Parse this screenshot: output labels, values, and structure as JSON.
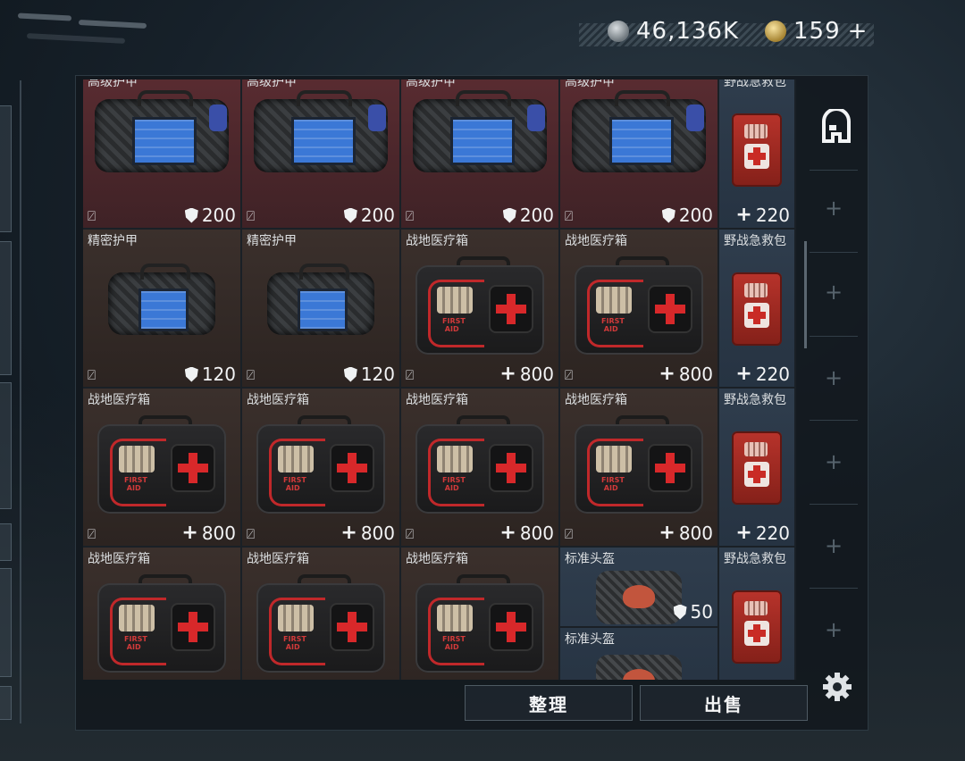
{
  "currency": {
    "silver": "46,136K",
    "gold": "159",
    "gold_suffix": "+"
  },
  "grid": {
    "rows": [
      [
        {
          "name": "高级护甲",
          "value": "200",
          "type": "shield",
          "kind": "armor-bag",
          "bg": "red"
        },
        {
          "name": "高级护甲",
          "value": "200",
          "type": "shield",
          "kind": "armor-bag",
          "bg": "red"
        },
        {
          "name": "高级护甲",
          "value": "200",
          "type": "shield",
          "kind": "armor-bag",
          "bg": "red"
        },
        {
          "name": "高级护甲",
          "value": "200",
          "type": "shield",
          "kind": "armor-bag",
          "bg": "red"
        },
        {
          "name": "野战急救包",
          "value": "220",
          "type": "plus",
          "kind": "pouch",
          "bg": "blue"
        }
      ],
      [
        {
          "name": "精密护甲",
          "value": "120",
          "type": "shield",
          "kind": "armor-small",
          "bg": "brown"
        },
        {
          "name": "精密护甲",
          "value": "120",
          "type": "shield",
          "kind": "armor-small",
          "bg": "brown"
        },
        {
          "name": "战地医疗箱",
          "value": "800",
          "type": "plus",
          "kind": "medkit",
          "bg": "brown"
        },
        {
          "name": "战地医疗箱",
          "value": "800",
          "type": "plus",
          "kind": "medkit",
          "bg": "brown"
        },
        {
          "name": "野战急救包",
          "value": "220",
          "type": "plus",
          "kind": "pouch",
          "bg": "blue"
        }
      ],
      [
        {
          "name": "战地医疗箱",
          "value": "800",
          "type": "plus",
          "kind": "medkit",
          "bg": "brown"
        },
        {
          "name": "战地医疗箱",
          "value": "800",
          "type": "plus",
          "kind": "medkit",
          "bg": "brown"
        },
        {
          "name": "战地医疗箱",
          "value": "800",
          "type": "plus",
          "kind": "medkit",
          "bg": "brown"
        },
        {
          "name": "战地医疗箱",
          "value": "800",
          "type": "plus",
          "kind": "medkit",
          "bg": "brown"
        },
        {
          "name": "野战急救包",
          "value": "220",
          "type": "plus",
          "kind": "pouch",
          "bg": "blue"
        }
      ],
      [
        {
          "name": "战地医疗箱",
          "value": "",
          "type": "",
          "kind": "medkit",
          "bg": "brown"
        },
        {
          "name": "战地医疗箱",
          "value": "",
          "type": "",
          "kind": "medkit",
          "bg": "brown"
        },
        {
          "name": "战地医疗箱",
          "value": "",
          "type": "",
          "kind": "medkit",
          "bg": "brown"
        },
        {
          "name": "标准头盔",
          "value": "50",
          "type": "shield",
          "kind": "helmet",
          "bg": "blue",
          "second_name": "标准头盔"
        },
        {
          "name": "野战急救包",
          "value": "",
          "type": "",
          "kind": "pouch",
          "bg": "blue"
        }
      ]
    ]
  },
  "icons": {
    "no_trade": "no-trade-icon",
    "durability": "shield-icon",
    "heal": "plus-icon",
    "backpack": "backpack-icon",
    "settings": "gear-icon"
  },
  "buttons": {
    "organize": "整理",
    "sell": "出售"
  },
  "sidebar": {
    "add_symbol": "+"
  },
  "colors": {
    "cell_red": "#5a2c31",
    "cell_brown": "#3b302c",
    "cell_blue": "#2f3d4d",
    "medkit_red": "#d8282a"
  }
}
